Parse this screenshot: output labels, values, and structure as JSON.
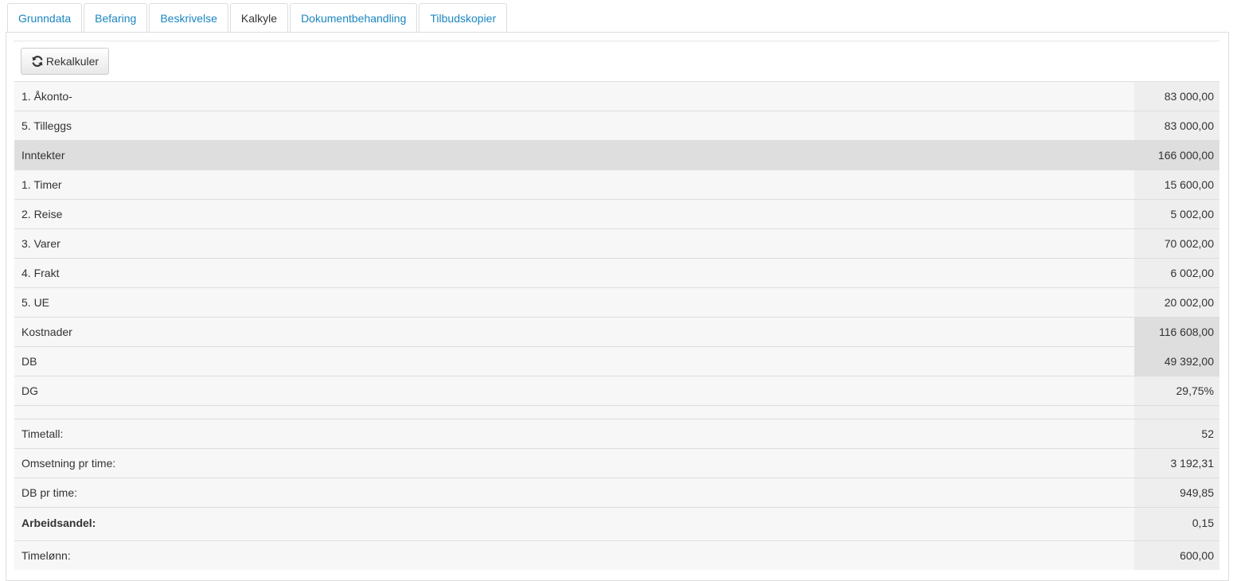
{
  "tabs": [
    {
      "label": "Grunndata"
    },
    {
      "label": "Befaring"
    },
    {
      "label": "Beskrivelse"
    },
    {
      "label": "Kalkyle"
    },
    {
      "label": "Dokumentbehandling"
    },
    {
      "label": "Tilbudskopier"
    }
  ],
  "active_tab": "Kalkyle",
  "toolbar": {
    "recalc_label": "Rekalkuler",
    "recalc_icon": "refresh-icon"
  },
  "rows": [
    {
      "label": "1. Åkonto-",
      "value": "83 000,00"
    },
    {
      "label": "5. Tilleggs",
      "value": "83 000,00"
    },
    {
      "label": "Inntekter",
      "value": "166 000,00"
    },
    {
      "label": "1. Timer",
      "value": "15 600,00"
    },
    {
      "label": "2. Reise",
      "value": "5 002,00"
    },
    {
      "label": "3. Varer",
      "value": "70 002,00"
    },
    {
      "label": "4. Frakt",
      "value": "6 002,00"
    },
    {
      "label": "5. UE",
      "value": "20 002,00"
    },
    {
      "label": "Kostnader",
      "value": "116 608,00"
    },
    {
      "label": "DB",
      "value": "49 392,00"
    },
    {
      "label": "DG",
      "value": "29,75%"
    },
    {
      "label": "",
      "value": ""
    },
    {
      "label": "Timetall:",
      "value": "52"
    },
    {
      "label": "Omsetning pr time:",
      "value": "3 192,31"
    },
    {
      "label": "DB pr time:",
      "value": "949,85"
    },
    {
      "label": "Arbeidsandel:",
      "value": "0,15"
    },
    {
      "label": "Timelønn:",
      "value": "600,00"
    }
  ],
  "colors": {
    "link": "#1a86c0",
    "row_bg": "#f7f7f7",
    "value_bg": "#eeeeee",
    "highlight_bg": "#dedede",
    "border": "#dddddd"
  }
}
